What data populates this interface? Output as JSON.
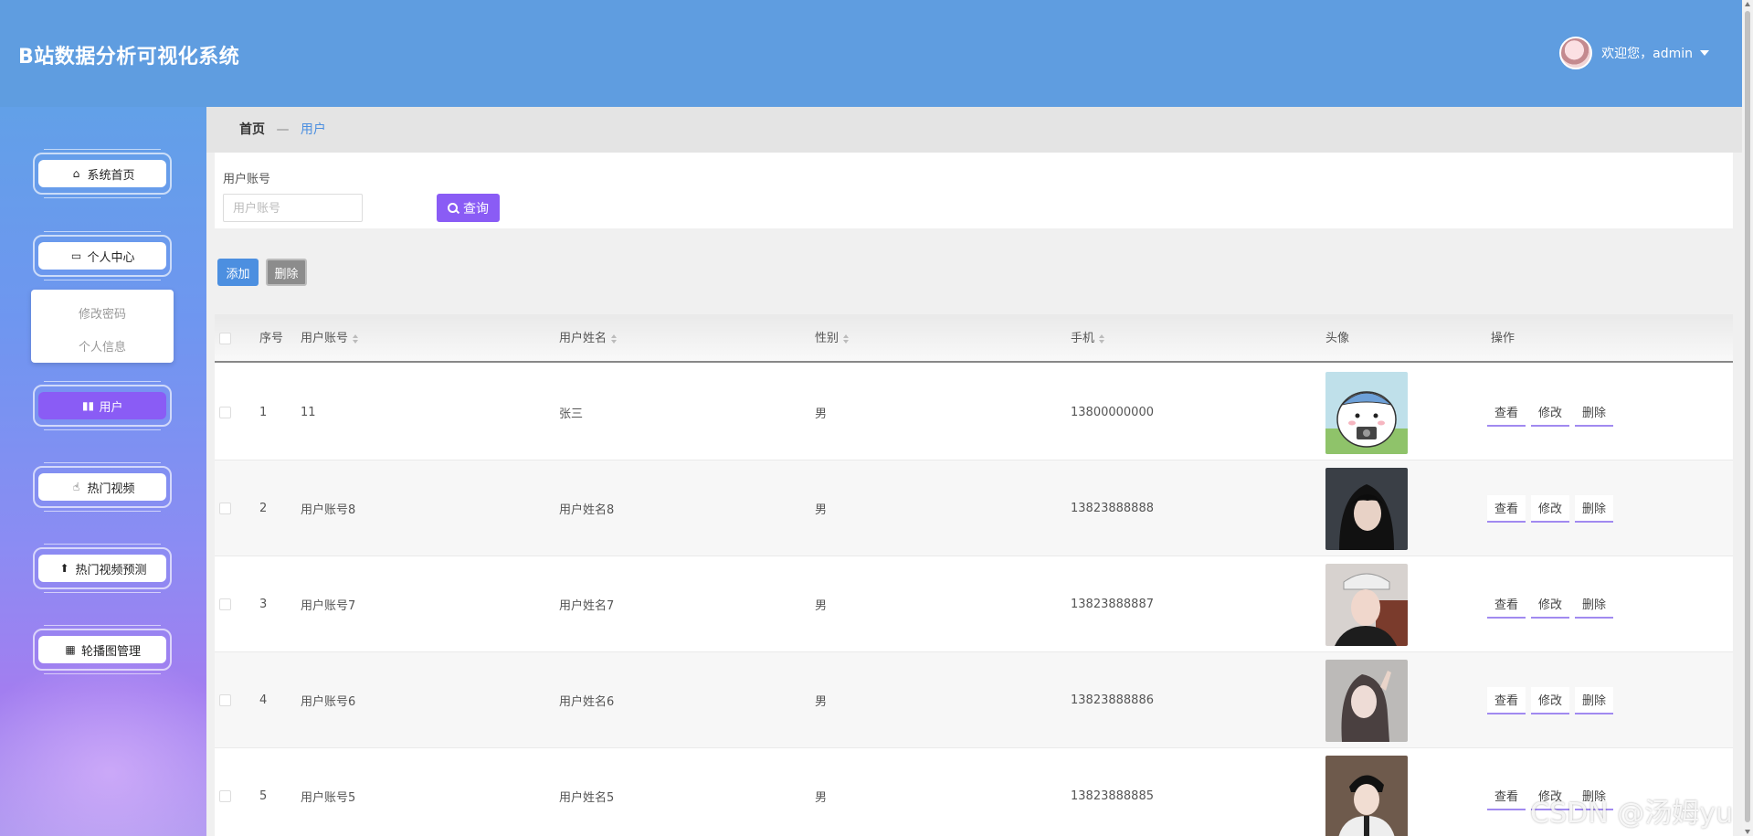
{
  "header": {
    "app_title": "B站数据分析可视化系统",
    "welcome": "欢迎您，admin"
  },
  "sidebar": {
    "items": [
      {
        "label": "系统首页",
        "icon": "home-icon"
      },
      {
        "label": "个人中心",
        "icon": "card-icon"
      },
      {
        "label": "用户",
        "icon": "book-icon",
        "active": true
      },
      {
        "label": "热门视频",
        "icon": "video-icon"
      },
      {
        "label": "热门视频预测",
        "icon": "user-upload-icon"
      },
      {
        "label": "轮播图管理",
        "icon": "grid-icon"
      }
    ],
    "submenu": [
      "修改密码",
      "个人信息"
    ]
  },
  "breadcrumb": {
    "home": "首页",
    "separator": "—",
    "current": "用户"
  },
  "search": {
    "label": "用户账号",
    "placeholder": "用户账号",
    "button": "查询"
  },
  "actions": {
    "add": "添加",
    "delete": "删除"
  },
  "table": {
    "columns": [
      "序号",
      "用户账号",
      "用户姓名",
      "性别",
      "手机",
      "头像",
      "操作"
    ],
    "row_actions": [
      "查看",
      "修改",
      "删除"
    ],
    "rows": [
      {
        "index": "1",
        "account": "11",
        "name": "张三",
        "gender": "男",
        "phone": "13800000000"
      },
      {
        "index": "2",
        "account": "用户账号8",
        "name": "用户姓名8",
        "gender": "男",
        "phone": "13823888888"
      },
      {
        "index": "3",
        "account": "用户账号7",
        "name": "用户姓名7",
        "gender": "男",
        "phone": "13823888887"
      },
      {
        "index": "4",
        "account": "用户账号6",
        "name": "用户姓名6",
        "gender": "男",
        "phone": "13823888886"
      },
      {
        "index": "5",
        "account": "用户账号5",
        "name": "用户姓名5",
        "gender": "男",
        "phone": "13823888885"
      }
    ]
  },
  "watermark": "CSDN @汤姆yu",
  "colors": {
    "header": "#5f9de0",
    "accent": "#8a5cf5",
    "add_button": "#4c8fe0"
  }
}
